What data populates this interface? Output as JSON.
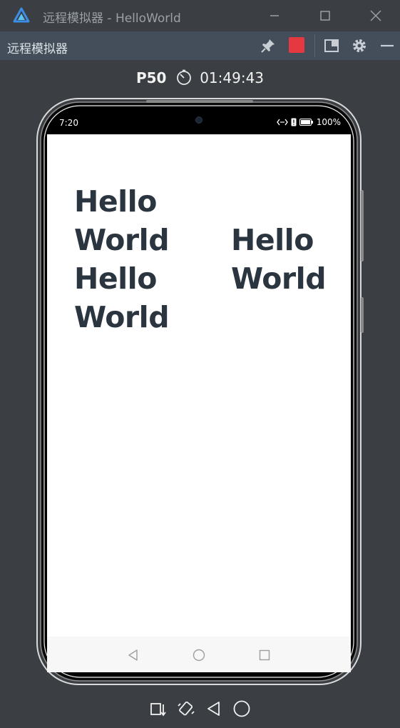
{
  "window": {
    "title": "远程模拟器 - HelloWorld"
  },
  "toolbar": {
    "title": "远程模拟器",
    "record_color": "#e5393f"
  },
  "device": {
    "model": "P50",
    "elapsed": "01:49:43"
  },
  "status_bar": {
    "time": "7:20",
    "battery": "100%"
  },
  "app": {
    "texts": [
      "Hello World",
      "Hello World",
      "Hello World"
    ],
    "text_color": "#2b3540"
  },
  "icons": {
    "window": [
      "app-logo-icon",
      "minimize-icon",
      "maximize-icon",
      "close-icon"
    ],
    "toolbar": [
      "pin-icon",
      "record-icon",
      "sidebar-toggle-icon",
      "gear-icon",
      "collapse-icon"
    ],
    "navigation": [
      "back-icon",
      "home-icon",
      "recents-icon"
    ],
    "bottom": [
      "rotate-icon",
      "shake-icon",
      "back-icon",
      "home-icon"
    ]
  }
}
